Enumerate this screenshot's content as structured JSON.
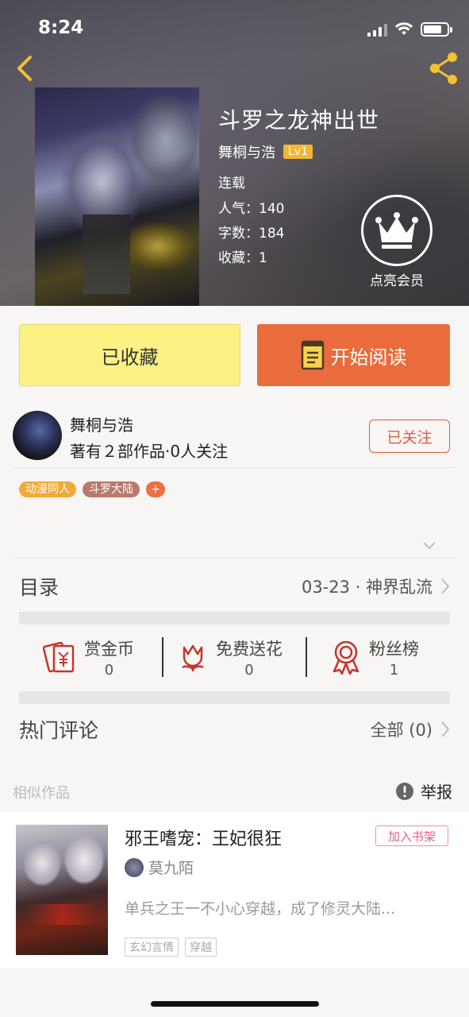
{
  "status_bar": {
    "time": "8:24"
  },
  "book": {
    "title": "斗罗之龙神出世",
    "author": "舞桐与浩",
    "level": "Lv1",
    "status": "连载",
    "popularity": "人气：140",
    "word_count": "字数：184",
    "favorites": "收藏：1"
  },
  "vip": {
    "label": "点亮会员"
  },
  "actions": {
    "collected_label": "已收藏",
    "read_label": "开始阅读"
  },
  "author_info": {
    "name": "舞桐与浩",
    "works": "著有２部作品·0人关注",
    "follow_label": "已关注"
  },
  "tags": [
    "动漫同人",
    "斗罗大陆",
    "+"
  ],
  "toc": {
    "label": "目录",
    "latest": "03-23 · 神界乱流"
  },
  "stats": [
    {
      "label": "赏金币",
      "value": "0",
      "icon": "red-envelope-icon"
    },
    {
      "label": "免费送花",
      "value": "0",
      "icon": "flower-icon"
    },
    {
      "label": "粉丝榜",
      "value": "1",
      "icon": "medal-icon"
    }
  ],
  "comments": {
    "label": "热门评论",
    "all": "全部 (0)"
  },
  "similar": {
    "label": "相似作品",
    "report_label": "举报",
    "items": [
      {
        "title": "邪王嗜宠：王妃很狂",
        "author": "莫九陌",
        "description": "单兵之王一不小心穿越，成了修灵大陆...",
        "add_label": "加入书架",
        "tags": [
          "玄幻言情",
          "穿越"
        ]
      }
    ]
  },
  "colors": {
    "accent_orange": "#ea6b3b",
    "collected_yellow": "#fbf283",
    "follow_red": "#e05a43",
    "level_gold": "#f2b631"
  }
}
